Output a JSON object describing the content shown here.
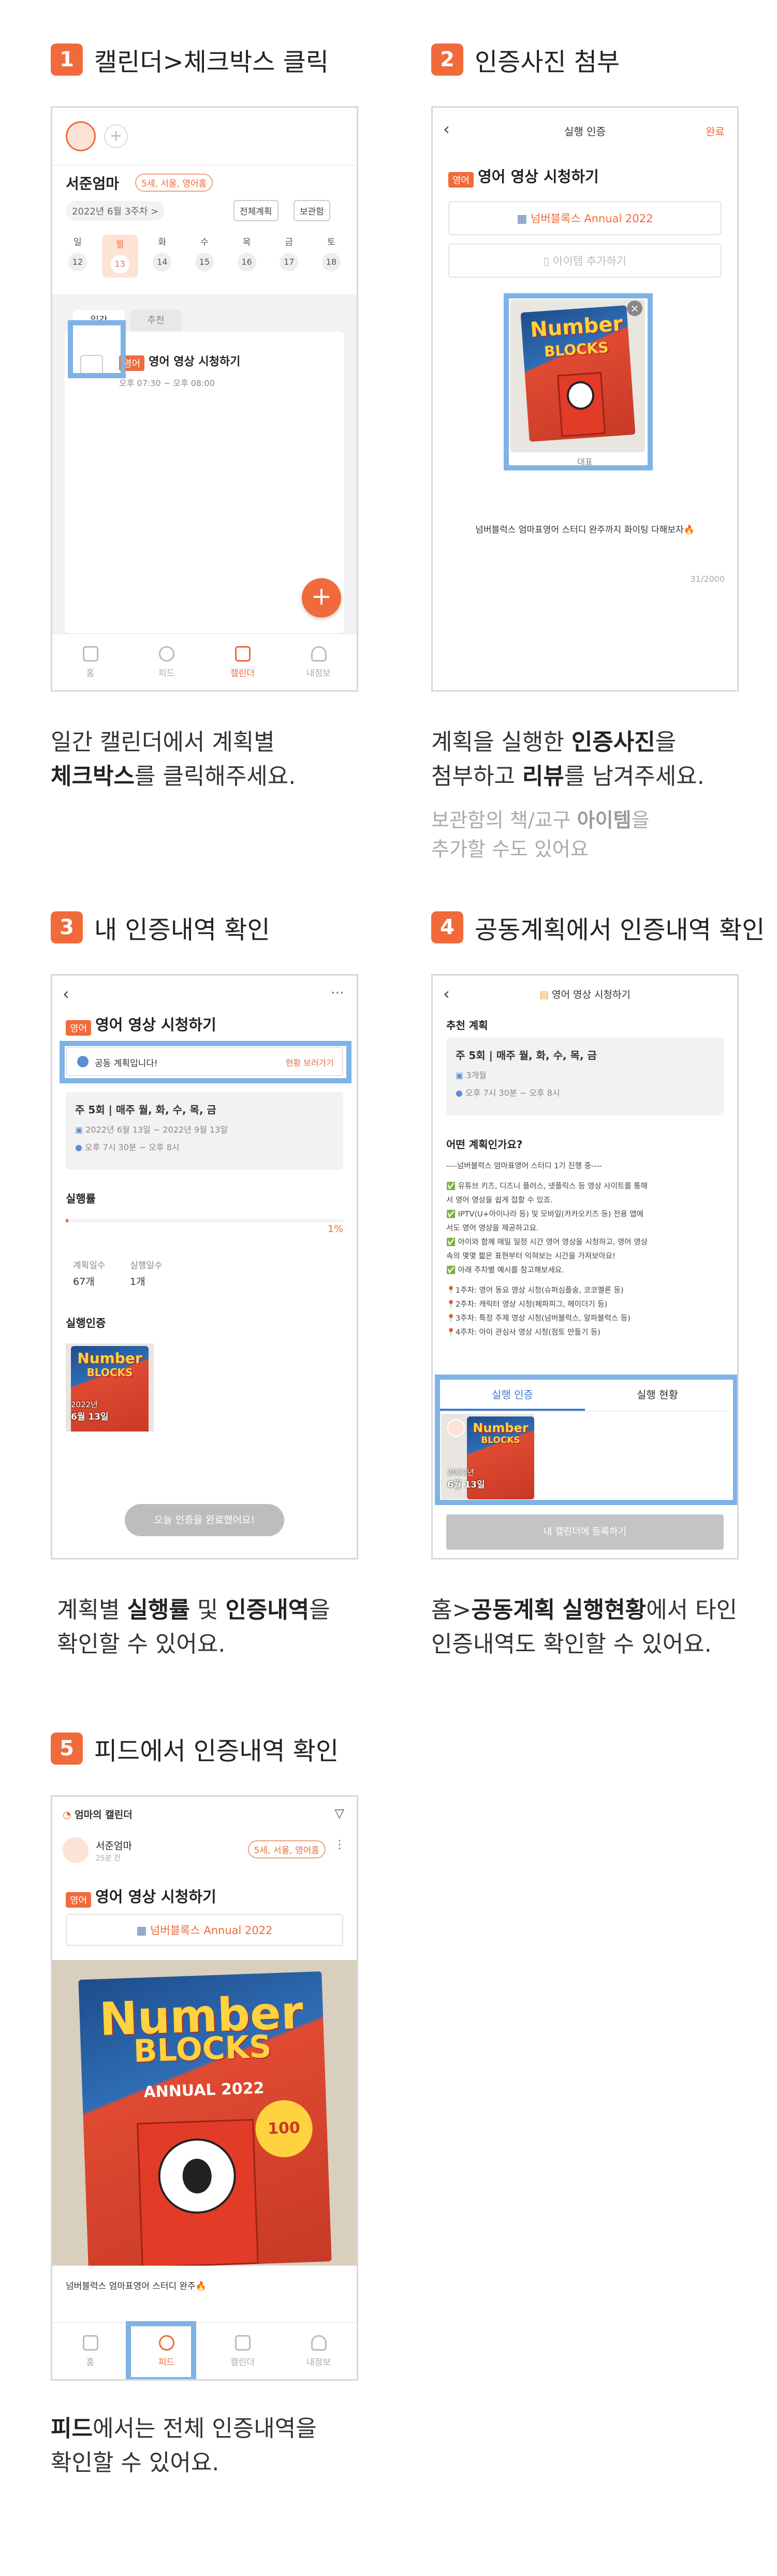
{
  "steps": [
    {
      "num": "1",
      "title": "캘린더>체크박스 클릭"
    },
    {
      "num": "2",
      "title": "인증사진 첨부"
    },
    {
      "num": "3",
      "title": "내 인증내역 확인"
    },
    {
      "num": "4",
      "title": "공동계획에서 인증내역 확인"
    },
    {
      "num": "5",
      "title": "피드에서 인증내역 확인"
    }
  ],
  "captions": {
    "c1_line1": "일간 캘린더에서 계획별",
    "c1_bold": "체크박스",
    "c1_rest": "를 클릭해주세요.",
    "c2_pre": "계획을 실행한 ",
    "c2_bold1": "인증사진",
    "c2_post": "을",
    "c2_pre2": "첨부하고 ",
    "c2_bold2": "리뷰",
    "c2_post2": "를 남겨주세요.",
    "c2_sub1_pre": "보관함의 책/교구 ",
    "c2_sub1_bold": "아이템",
    "c2_sub1_post": "을",
    "c2_sub2": "추가할 수도 있어요",
    "c3_pre": "계획별 ",
    "c3_bold1": "실행률",
    "c3_mid": " 및 ",
    "c3_bold2": "인증내역",
    "c3_post": "을",
    "c3_line2": "확인할 수 있어요.",
    "c4_pre": "홈>",
    "c4_bold1": "공동계획",
    "c4_sp": " ",
    "c4_bold2": "실행현황",
    "c4_post": "에서 타인",
    "c4_line2": "인증내역도 확인할 수 있어요.",
    "c5_bold": "피드",
    "c5_post": "에서는 전체 인증내역을",
    "c5_line2": "확인할 수 있어요."
  },
  "screen1": {
    "user": "서준엄마",
    "tag": "5세, 서울, 영어홈",
    "week": "2022년 6월 3주차 >",
    "btn_all": "전체계획",
    "btn_box": "보관함",
    "days": [
      {
        "d": "일",
        "n": "12"
      },
      {
        "d": "월",
        "n": "13"
      },
      {
        "d": "화",
        "n": "14"
      },
      {
        "d": "수",
        "n": "15"
      },
      {
        "d": "목",
        "n": "16"
      },
      {
        "d": "금",
        "n": "17"
      },
      {
        "d": "토",
        "n": "18"
      }
    ],
    "tab_daily": "일간",
    "tab_rec": "추천",
    "chip": "영어",
    "plan": "영어 영상 시청하기",
    "time": "오후 07:30 ~ 오후 08:00",
    "fab": "+",
    "nav": [
      "홈",
      "피드",
      "캘린더",
      "내정보"
    ]
  },
  "screen2": {
    "header": "실행 인증",
    "done": "완료",
    "chip": "영어",
    "plan": "영어 영상 시청하기",
    "item": "넘버블록스 Annual 2022",
    "add_item": "아이템 추가하기",
    "repr": "대표",
    "review": "넘버블럭스 엄마표영어 스터디 완주까지 화이팅 다해보자🔥",
    "count": "31/2000"
  },
  "screen3": {
    "chip": "영어",
    "plan": "영어 영상 시청하기",
    "shared": "공동 계획입니다!",
    "shared_link": "현황 보러가기",
    "freq": "주 5회 | 매주 월, 화, 수, 목, 금",
    "date": "2022년 6월 13일 ~ 2022년 9월 13일",
    "time": "오후 7시 30분 ~ 오후 8시",
    "rate_label": "실행률",
    "rate": "1%",
    "plan_days_label": "계획일수",
    "plan_days": "67개",
    "done_days_label": "실행일수",
    "done_days": "1개",
    "cert_label": "실행인증",
    "thumb_year": "2022년",
    "thumb_date": "6월 13일",
    "complete_btn": "오늘 인증을 완료했어요!"
  },
  "screen4": {
    "header": "영어 영상 시청하기",
    "rec": "추천 계획",
    "freq": "주 5회 | 매주 월, 화, 수, 목, 금",
    "months": "3개월",
    "time": "오후 7시 30분 ~ 오후 8시",
    "what": "어떤 계획인가요?",
    "desc": [
      "----넘버블럭스 엄마표영어 스터디 1기 진행 중----",
      "",
      "✅ 유튜브 키즈, 디즈니 플러스, 넷플릭스 등 영상 사이트를 통해",
      "서 영어 영상을 쉽게 접할 수 있죠.",
      "✅ IPTV(U+아이나라 등) 및 모바일(카카오키즈 등) 전용 앱에",
      "서도 영어 영상을 제공하고요.",
      "✅ 아이와 함께 매일 일정 시간 영어 영상을 시청하고, 영어 영상",
      "속의 몇몇 짧은 표현부터 익혀보는 시간을 가져보아요!",
      "✅ 아래 주차별 예시를 참고해보세요.",
      "",
      "📍1주차: 영어 동요 영상 시청(슈퍼심플송, 코코멜론 등)",
      "📍2주차: 캐릭터 영상 시청(페파피그, 헤이더기 등)",
      "📍3주차: 특정 주제 영상 시청(넘버블럭스, 알파블럭스 등)",
      "📍4주차: 아이 관심사 영상 시청(점토 만들기 등)"
    ],
    "tab_cert": "실행 인증",
    "tab_status": "실행 현황",
    "thumb_year": "2022년",
    "thumb_date": "6월 13일",
    "register": "내 캘린더에 등록하기"
  },
  "screen5": {
    "logo": "엄마의 캘린더",
    "user": "서준엄마",
    "ago": "25분 전",
    "tag": "5세, 서울, 영어홈",
    "chip": "영어",
    "plan": "영어 영상 시청하기",
    "item": "넘버블록스 Annual 2022",
    "review": "넘버블럭스 엄마표영어 스터디 완주🔥",
    "nav": [
      "홈",
      "피드",
      "캘린더",
      "내정보"
    ]
  },
  "book": {
    "t1": "Number",
    "t2": "BLOCKS",
    "annual": "ANNUAL 2022",
    "badge": "100"
  },
  "colors": {
    "accent": "#f06a3b",
    "highlight": "#7fb3e6"
  }
}
